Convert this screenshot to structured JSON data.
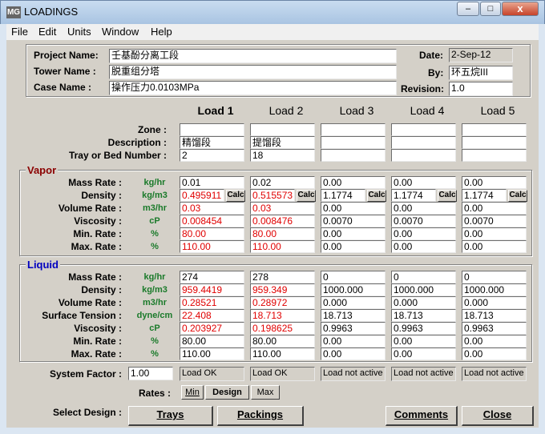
{
  "window": {
    "title": "LOADINGS",
    "app_icon": "MG",
    "min": "–",
    "max": "□",
    "close": "x"
  },
  "menu": [
    "File",
    "Edit",
    "Units",
    "Window",
    "Help"
  ],
  "project": {
    "project_name_label": "Project Name:",
    "project_name": "壬基酚分离工段",
    "tower_name_label": "Tower Name :",
    "tower_name": "脱重组分塔",
    "case_name_label": "Case Name :",
    "case_name": "操作压力0.0103MPa",
    "date_label": "Date:",
    "date": "2-Sep-12",
    "by_label": "By:",
    "by": "环五烷III",
    "revision_label": "Revision:",
    "revision": "1.0"
  },
  "loads": [
    "Load 1",
    "Load 2",
    "Load 3",
    "Load 4",
    "Load 5"
  ],
  "general_labels": {
    "zone": "Zone :",
    "description": "Description :",
    "tray": "Tray or Bed Number :"
  },
  "general": {
    "zone": [
      "",
      "",
      "",
      "",
      ""
    ],
    "description": [
      "精馏段",
      "提馏段",
      "",
      "",
      ""
    ],
    "tray": [
      "2",
      "18",
      "",
      "",
      ""
    ]
  },
  "vapor": {
    "title": "Vapor",
    "calc_label": "Calc",
    "rows": [
      {
        "label": "Mass Rate :",
        "unit": "kg/hr",
        "values": [
          "0.01",
          "0.02",
          "0.00",
          "0.00",
          "0.00"
        ],
        "red": [
          false,
          false,
          false,
          false,
          false
        ]
      },
      {
        "label": "Density :",
        "unit": "kg/m3",
        "values": [
          "0.495911",
          "0.515573",
          "1.1774",
          "1.1774",
          "1.1774"
        ],
        "red": [
          true,
          true,
          false,
          false,
          false
        ]
      },
      {
        "label": "Volume Rate :",
        "unit": "m3/hr",
        "values": [
          "0.03",
          "0.03",
          "0.00",
          "0.00",
          "0.00"
        ],
        "red": [
          true,
          true,
          false,
          false,
          false
        ]
      },
      {
        "label": "Viscosity :",
        "unit": "cP",
        "values": [
          "0.008454",
          "0.008476",
          "0.0070",
          "0.0070",
          "0.0070"
        ],
        "red": [
          true,
          true,
          false,
          false,
          false
        ]
      },
      {
        "label": "Min. Rate :",
        "unit": "%",
        "values": [
          "80.00",
          "80.00",
          "0.00",
          "0.00",
          "0.00"
        ],
        "red": [
          true,
          true,
          false,
          false,
          false
        ]
      },
      {
        "label": "Max. Rate :",
        "unit": "%",
        "values": [
          "110.00",
          "110.00",
          "0.00",
          "0.00",
          "0.00"
        ],
        "red": [
          true,
          true,
          false,
          false,
          false
        ]
      }
    ]
  },
  "liquid": {
    "title": "Liquid",
    "rows": [
      {
        "label": "Mass Rate :",
        "unit": "kg/hr",
        "values": [
          "274",
          "278",
          "0",
          "0",
          "0"
        ],
        "red": [
          false,
          false,
          false,
          false,
          false
        ]
      },
      {
        "label": "Density :",
        "unit": "kg/m3",
        "values": [
          "959.4419",
          "959.349",
          "1000.000",
          "1000.000",
          "1000.000"
        ],
        "red": [
          true,
          true,
          false,
          false,
          false
        ]
      },
      {
        "label": "Volume Rate :",
        "unit": "m3/hr",
        "values": [
          "0.28521",
          "0.28972",
          "0.000",
          "0.000",
          "0.000"
        ],
        "red": [
          true,
          true,
          false,
          false,
          false
        ]
      },
      {
        "label": "Surface Tension :",
        "unit": "dyne/cm",
        "values": [
          "22.408",
          "18.713",
          "18.713",
          "18.713",
          "18.713"
        ],
        "red": [
          true,
          true,
          false,
          false,
          false
        ]
      },
      {
        "label": "Viscosity :",
        "unit": "cP",
        "values": [
          "0.203927",
          "0.198625",
          "0.9963",
          "0.9963",
          "0.9963"
        ],
        "red": [
          true,
          true,
          false,
          false,
          false
        ]
      },
      {
        "label": "Min. Rate :",
        "unit": "%",
        "values": [
          "80.00",
          "80.00",
          "0.00",
          "0.00",
          "0.00"
        ],
        "red": [
          false,
          false,
          false,
          false,
          false
        ]
      },
      {
        "label": "Max. Rate :",
        "unit": "%",
        "values": [
          "110.00",
          "110.00",
          "0.00",
          "0.00",
          "0.00"
        ],
        "red": [
          false,
          false,
          false,
          false,
          false
        ]
      }
    ]
  },
  "system_factor": {
    "label": "System Factor :",
    "value": "1.00"
  },
  "status": [
    "Load OK",
    "Load OK",
    "Load not active",
    "Load not active",
    "Load not active"
  ],
  "rates": {
    "label": "Rates :",
    "min": "Min",
    "design": "Design",
    "max": "Max"
  },
  "buttons": {
    "select_design_label": "Select Design :",
    "trays": "Trays",
    "packings": "Packings",
    "comments": "Comments",
    "close": "Close"
  },
  "colors": {
    "red_value": "#e00000",
    "unit_green": "#1a7a2a",
    "vapor_title": "#8b0000",
    "liquid_title": "#0000c0"
  }
}
